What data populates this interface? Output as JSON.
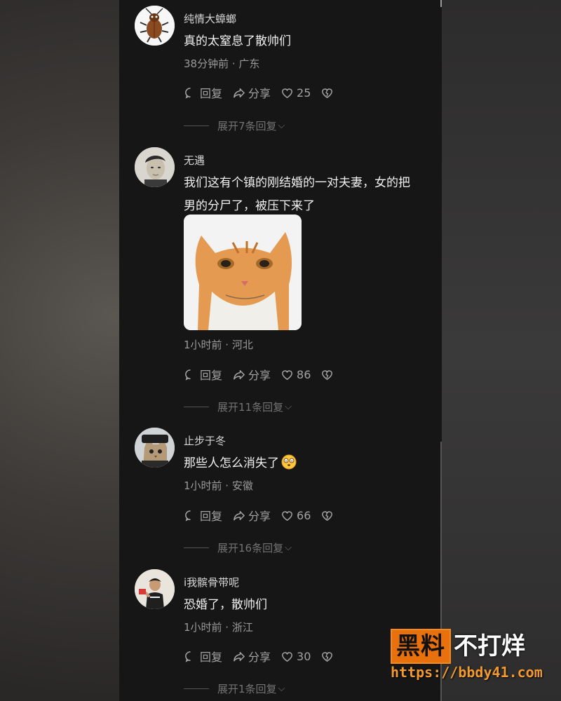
{
  "labels": {
    "reply": "回复",
    "share": "分享"
  },
  "comments": [
    {
      "username": "纯情大蟑螂",
      "text_lines": [
        "真的太窒息了散帅们"
      ],
      "meta": "38分钟前 · 广东",
      "likes": "25",
      "expand": "展开7条回复",
      "avatar_icon": "cockroach-avatar"
    },
    {
      "username": "无遇",
      "text_lines": [
        "我们这有个镇的刚结婚的一对夫妻，女的把",
        "男的分尸了，被压下来了"
      ],
      "meta": "1小时前 · 河北",
      "likes": "86",
      "expand": "展开11条回复",
      "avatar_icon": "person-avatar",
      "sticker": "cat-sticker"
    },
    {
      "username": "止步于冬",
      "text_lines": [
        "那些人怎么消失了"
      ],
      "meta": "1小时前 · 安徽",
      "likes": "66",
      "expand": "展开16条回复",
      "avatar_icon": "cat-avatar",
      "emoji": "dizzy-face-emoji"
    },
    {
      "username": "i我髌骨带呢",
      "text_lines": [
        "恐婚了，散帅们"
      ],
      "meta": "1小时前 · 浙江",
      "likes": "30",
      "expand": "展开1条回复",
      "avatar_icon": "boy-avatar"
    }
  ],
  "watermark": {
    "box_text": "黑料",
    "rest_text": "不打烊",
    "url": "https://bbdy41.com",
    "accent_color": "#e8700d"
  }
}
